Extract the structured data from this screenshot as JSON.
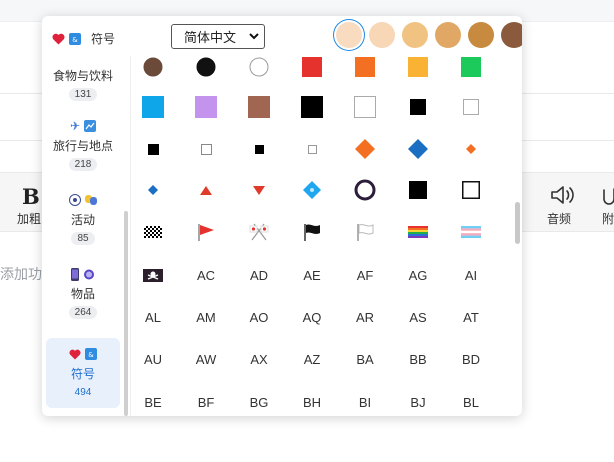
{
  "editor": {
    "bold_label": "加粗",
    "audio_label": "音频",
    "attach_label": "附",
    "placeholder": "添加功"
  },
  "picker": {
    "title": "符号",
    "language": "简体中文",
    "skin_tones": [
      "#f9dcc0",
      "#f7d7b6",
      "#f0c383",
      "#e0a864",
      "#c78a3e",
      "#8b5a3c"
    ],
    "selected_tone": 0,
    "categories": [
      {
        "name": "食物与饮料",
        "count": "131",
        "icons": [
          "food-icon"
        ]
      },
      {
        "name": "旅行与地点",
        "count": "218",
        "icons": [
          "airplane-icon",
          "map-icon"
        ]
      },
      {
        "name": "活动",
        "count": "85",
        "icons": [
          "soccer-icon",
          "masks-icon"
        ]
      },
      {
        "name": "物品",
        "count": "264",
        "icons": [
          "phone-icon",
          "watch-icon"
        ]
      },
      {
        "name": "符号",
        "count": "494",
        "icons": [
          "heart-icon",
          "symbols-icon"
        ],
        "active": true
      }
    ],
    "flag_codes": [
      "AC",
      "AD",
      "AE",
      "AF",
      "AG",
      "AI",
      "AL",
      "AM",
      "AO",
      "AQ",
      "AR",
      "AS",
      "AT",
      "AU",
      "AW",
      "AX",
      "AZ",
      "BA",
      "BB",
      "BD",
      "BE",
      "BF",
      "BG",
      "BH",
      "BI",
      "BJ",
      "BL"
    ]
  }
}
